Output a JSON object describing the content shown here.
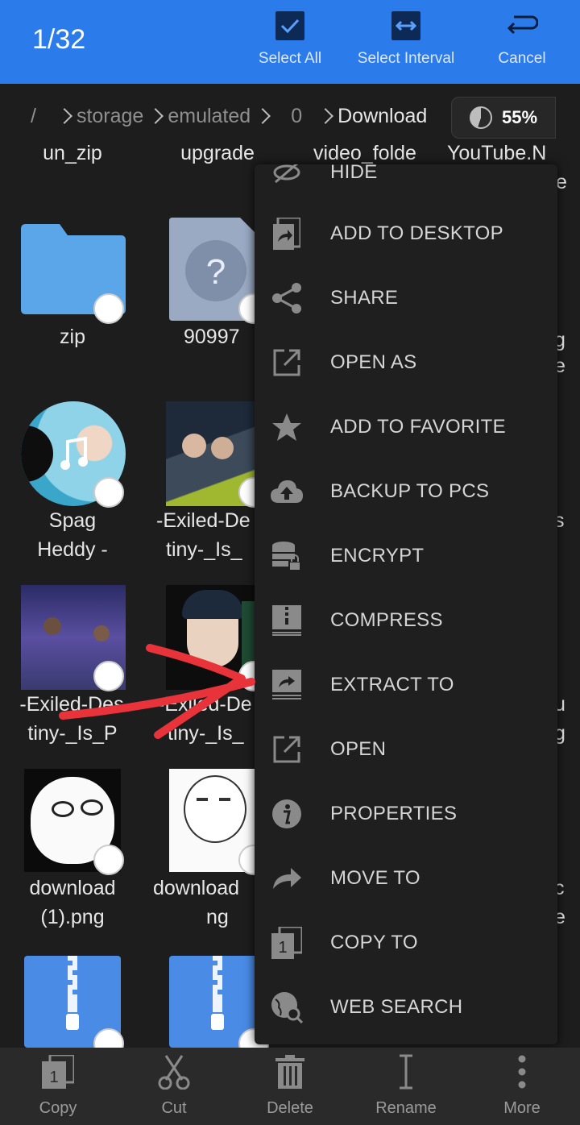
{
  "header": {
    "counter": "1/32",
    "select_all": "Select All",
    "select_interval": "Select Interval",
    "cancel": "Cancel"
  },
  "breadcrumb": [
    "/",
    "storage",
    "emulated",
    "0",
    "Download"
  ],
  "storage": {
    "percent_label": "55%",
    "used_fraction": 0.55
  },
  "files": {
    "row0": [
      "un_zip",
      "upgrade",
      "video_folde",
      "YouTube.N"
    ],
    "row0_extra": "e",
    "zip": "zip",
    "unknown": "90997",
    "spag1": "Spag",
    "spag2": "Heddy -",
    "exiled1a": "-Exiled-De",
    "exiled1b": "tiny-_Is_",
    "exiled2a": "-Exiled-Des",
    "exiled2b": "tiny-_Is_P",
    "exiled3a": "-Exiled-De",
    "exiled3b": "tiny-_Is_",
    "dl1a": "download",
    "dl1b": "(1).png",
    "dl2a": "download",
    "dl2b": "ng",
    "side_g": "g",
    "side_e": "e",
    "side_s": "s",
    "side_u": "u",
    "side_g2": "g",
    "side_c": "c",
    "side_e2": "e"
  },
  "menu": {
    "hide": "HIDE",
    "items": [
      "ADD TO DESKTOP",
      "SHARE",
      "OPEN AS",
      "ADD TO FAVORITE",
      "BACKUP TO PCS",
      "ENCRYPT",
      "COMPRESS",
      "EXTRACT TO",
      "OPEN",
      "PROPERTIES",
      "MOVE TO",
      "COPY TO",
      "WEB SEARCH"
    ]
  },
  "bottom": {
    "copy": "Copy",
    "cut": "Cut",
    "delete": "Delete",
    "rename": "Rename",
    "more": "More"
  },
  "colors": {
    "accent": "#2b7bea",
    "annotation": "#e8333a"
  }
}
